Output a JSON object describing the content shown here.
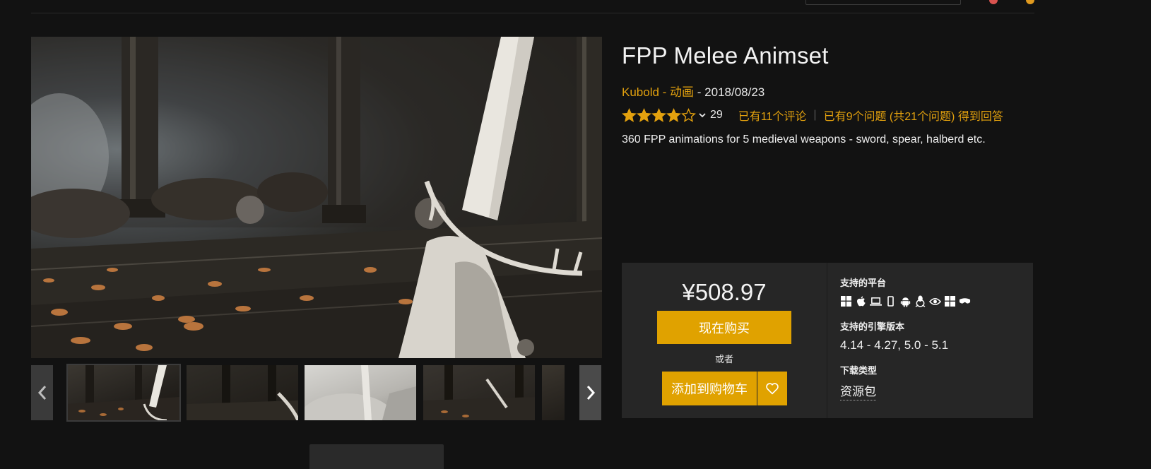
{
  "product": {
    "title": "FPP Melee Animset",
    "author": "Kubold",
    "category": "动画",
    "date": "2018/08/23",
    "separator": " - ",
    "rating": {
      "stars": 4,
      "max_stars": 5,
      "count": "29"
    },
    "reviews_link": "已有11个评论",
    "qa_link": "已有9个问题 (共21个问题) 得到回答",
    "description": "360 FPP animations for 5 medieval weapons - sword, spear, halberd etc."
  },
  "gallery": {
    "prev_icon": "chevron-left-icon",
    "next_icon": "chevron-right-icon",
    "thumbnail_count": 5,
    "selected_thumbnail": 1
  },
  "purchase": {
    "price": "¥508.97",
    "buy_now_label": "现在购买",
    "or_label": "或者",
    "add_to_cart_label": "添加到购物车",
    "wishlist_icon": "heart-icon",
    "accent_color": "#e0a200"
  },
  "specs": {
    "platforms_label": "支持的平台",
    "platform_icons": [
      "windows-icon",
      "apple-icon",
      "laptop-icon",
      "mobile-icon",
      "android-icon",
      "linux-icon",
      "eye-vr-icon",
      "windows-icon",
      "vr-headset-icon"
    ],
    "engine_label": "支持的引擎版本",
    "engine_versions": "4.14 - 4.27, 5.0 - 5.1",
    "download_label": "下载类型",
    "download_type": "资源包"
  },
  "colors": {
    "link": "#e3a10e",
    "background": "#121212",
    "panel": "#262626"
  }
}
